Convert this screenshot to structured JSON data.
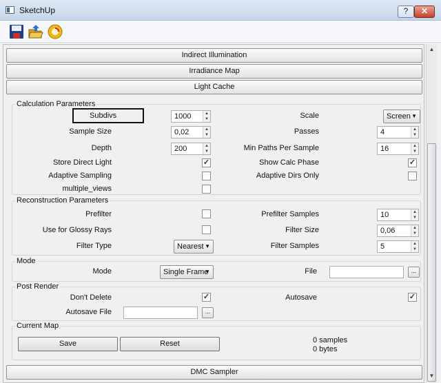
{
  "window": {
    "title": "SketchUp",
    "help_btn": "?",
    "close_btn": "✕"
  },
  "toolbar": {
    "icons": [
      "save-icon",
      "open-folder-icon",
      "render-icon"
    ]
  },
  "sections": {
    "indirect": "Indirect Illumination",
    "irradiance": "Irradiance Map",
    "light_cache": "Light Cache",
    "dmc": "DMC Sampler"
  },
  "calc": {
    "title": "Calculation Parameters",
    "subdivs_label": "Subdivs",
    "subdivs_value": "1000",
    "sample_size_label": "Sample Size",
    "sample_size_value": "0,02",
    "depth_label": "Depth",
    "depth_value": "200",
    "store_direct_label": "Store Direct Light",
    "store_direct": true,
    "adaptive_sampling_label": "Adaptive Sampling",
    "adaptive_sampling": false,
    "multiple_views_label": "multiple_views",
    "multiple_views": false,
    "scale_label": "Scale",
    "scale_value": "Screen",
    "passes_label": "Passes",
    "passes_value": "4",
    "min_paths_label": "Min Paths Per Sample",
    "min_paths_value": "16",
    "show_calc_label": "Show Calc Phase",
    "show_calc": true,
    "adaptive_dirs_label": "Adaptive Dirs Only",
    "adaptive_dirs": false
  },
  "recon": {
    "title": "Reconstruction Parameters",
    "prefilter_label": "Prefilter",
    "prefilter": false,
    "glossy_label": "Use for Glossy Rays",
    "glossy": false,
    "filter_type_label": "Filter Type",
    "filter_type_value": "Nearest",
    "prefilter_samples_label": "Prefilter Samples",
    "prefilter_samples_value": "10",
    "filter_size_label": "Filter Size",
    "filter_size_value": "0,06",
    "filter_samples_label": "Filter Samples",
    "filter_samples_value": "5"
  },
  "mode": {
    "title": "Mode",
    "mode_label": "Mode",
    "mode_value": "Single Frame",
    "file_label": "File",
    "file_value": "",
    "browse": "..."
  },
  "post": {
    "title": "Post Render",
    "dont_delete_label": "Don't Delete",
    "dont_delete": true,
    "autosave_file_label": "Autosave File",
    "autosave_file_value": "",
    "browse": "...",
    "autosave_label": "Autosave",
    "autosave": true
  },
  "current_map": {
    "title": "Current Map",
    "save_label": "Save",
    "reset_label": "Reset",
    "samples": "0 samples",
    "bytes": "0 bytes"
  },
  "colors": {
    "title_bar": "#c4d5ea",
    "close": "#c6412c",
    "panel": "#f0f0f0"
  }
}
